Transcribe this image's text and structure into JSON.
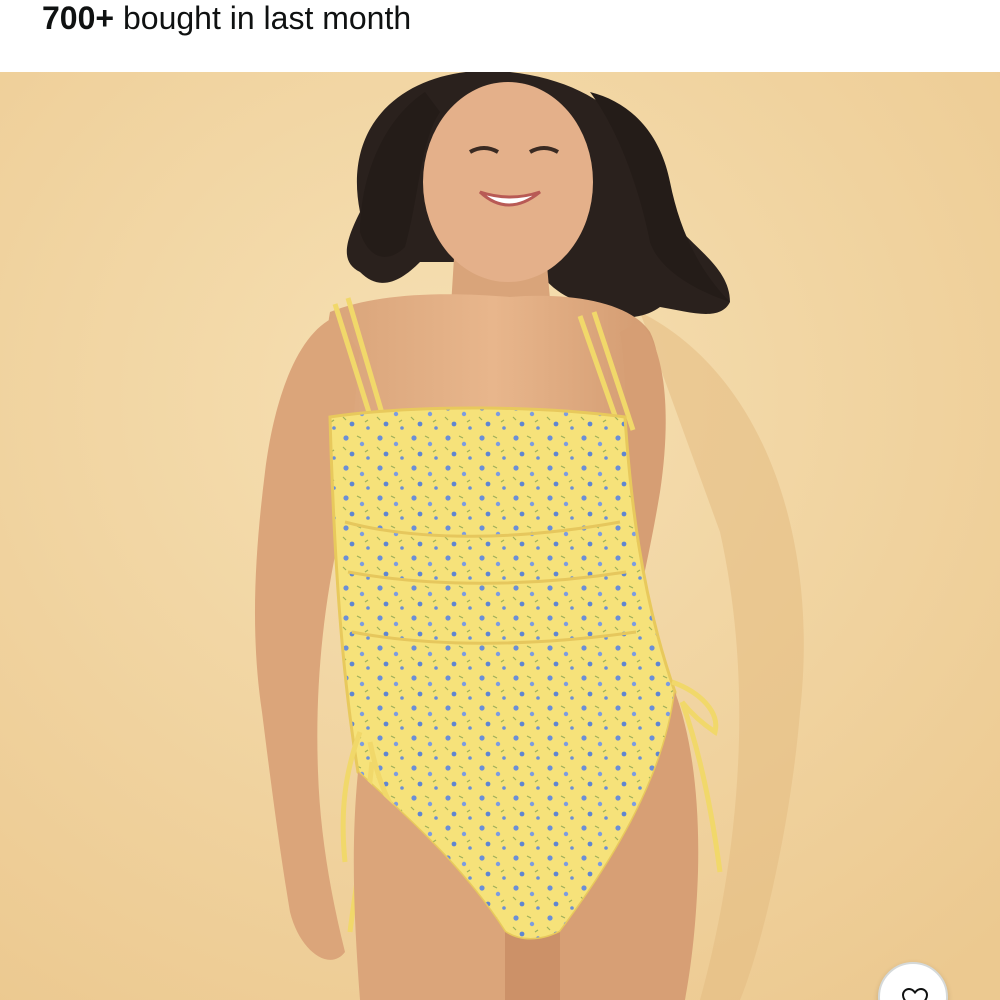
{
  "purchase_info": {
    "count": "700+",
    "text": "bought in last month"
  },
  "product_image": {
    "alt": "Model wearing a yellow floral one-piece swimsuit with side ties",
    "background_color": "#f2d7a5",
    "swimsuit_color": "#f6e27a",
    "print_color": "#6b8fd6"
  },
  "favorite_button": {
    "icon": "heart-outline-icon"
  }
}
